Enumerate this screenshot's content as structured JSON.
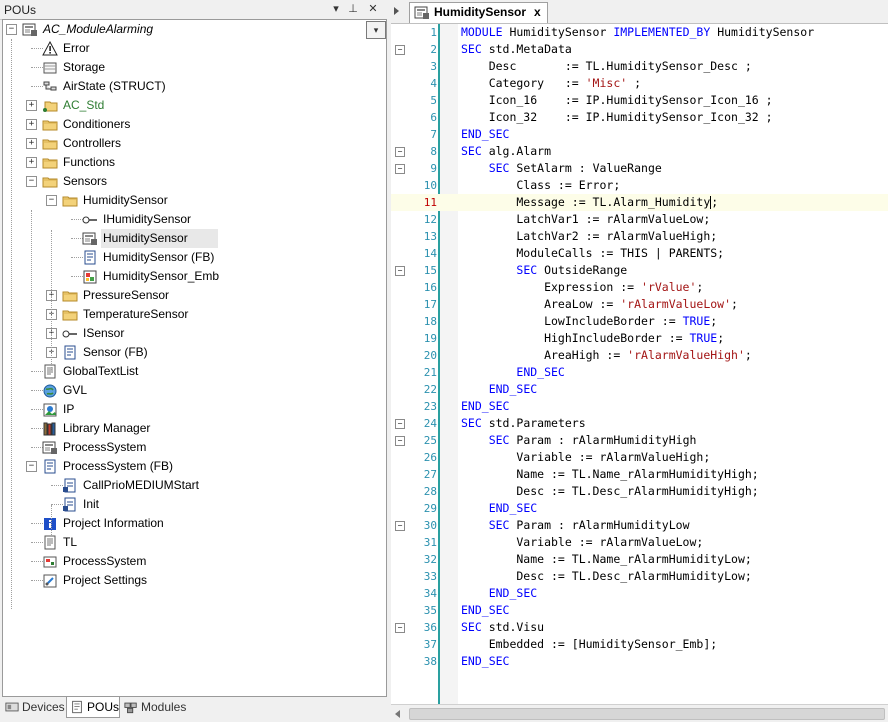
{
  "left_panel": {
    "title": "POUs",
    "buttons": {
      "dropdown": "▾",
      "pin": "⊥",
      "close": "✕"
    },
    "root_dropdown": "▾",
    "tree": [
      {
        "label": "AC_ModuleAlarming",
        "icon": "module-icon",
        "italic": true
      },
      {
        "label": "Error",
        "icon": "warning-icon"
      },
      {
        "label": "Storage",
        "icon": "storage-icon"
      },
      {
        "label": "AirState (STRUCT)",
        "icon": "struct-icon"
      },
      {
        "label": "AC_Std",
        "icon": "folder-link-icon",
        "color": "#2e7d32"
      },
      {
        "label": "Conditioners",
        "icon": "folder-icon"
      },
      {
        "label": "Controllers",
        "icon": "folder-icon"
      },
      {
        "label": "Functions",
        "icon": "folder-icon"
      },
      {
        "label": "Sensors",
        "icon": "folder-icon"
      },
      {
        "label": "HumiditySensor",
        "icon": "folder-icon"
      },
      {
        "label": "IHumiditySensor",
        "icon": "interface-icon"
      },
      {
        "label": "HumiditySensor",
        "icon": "module-icon",
        "selected": true
      },
      {
        "label": "HumiditySensor (FB)",
        "icon": "function-block-icon"
      },
      {
        "label": "HumiditySensor_Emb",
        "icon": "visualization-icon"
      },
      {
        "label": "PressureSensor",
        "icon": "folder-icon"
      },
      {
        "label": "TemperatureSensor",
        "icon": "folder-icon"
      },
      {
        "label": "ISensor",
        "icon": "interface-icon"
      },
      {
        "label": "Sensor (FB)",
        "icon": "function-block-icon"
      },
      {
        "label": "GlobalTextList",
        "icon": "text-list-icon"
      },
      {
        "label": "GVL",
        "icon": "globe-icon"
      },
      {
        "label": "IP",
        "icon": "image-pool-icon"
      },
      {
        "label": "Library Manager",
        "icon": "library-icon"
      },
      {
        "label": "ProcessSystem",
        "icon": "module-icon"
      },
      {
        "label": "ProcessSystem (FB)",
        "icon": "function-block-icon"
      },
      {
        "label": "CallPrioMEDIUMStart",
        "icon": "method-icon"
      },
      {
        "label": "Init",
        "icon": "method-icon"
      },
      {
        "label": "Project Information",
        "icon": "info-icon"
      },
      {
        "label": "TL",
        "icon": "text-list-icon"
      },
      {
        "label": "ProcessSystem",
        "icon": "task-icon"
      },
      {
        "label": "Project Settings",
        "icon": "settings-icon"
      }
    ]
  },
  "bottom_tabs": [
    {
      "label": "Devices",
      "icon": "devices-icon"
    },
    {
      "label": "POUs",
      "icon": "pous-icon",
      "active": true
    },
    {
      "label": "Modules",
      "icon": "modules-icon"
    }
  ],
  "editor": {
    "tab_title": "HumiditySensor",
    "tab_close": "x",
    "current_line": 11,
    "lines": [
      "MODULE HumiditySensor IMPLEMENTED_BY HumiditySensor",
      "SEC std.MetaData",
      "    Desc       := TL.HumiditySensor_Desc ;",
      "    Category   := 'Misc' ;",
      "    Icon_16    := IP.HumiditySensor_Icon_16 ;",
      "    Icon_32    := IP.HumiditySensor_Icon_32 ;",
      "END_SEC",
      "SEC alg.Alarm",
      "    SEC SetAlarm : ValueRange",
      "        Class := Error;",
      "        Message := TL.Alarm_Humidity;",
      "        LatchVar1 := rAlarmValueLow;",
      "        LatchVar2 := rAlarmValueHigh;",
      "        ModuleCalls := THIS | PARENTS;",
      "        SEC OutsideRange",
      "            Expression := 'rValue';",
      "            AreaLow := 'rAlarmValueLow';",
      "            LowIncludeBorder := TRUE;",
      "            HighIncludeBorder := TRUE;",
      "            AreaHigh := 'rAlarmValueHigh';",
      "        END_SEC",
      "    END_SEC",
      "END_SEC",
      "SEC std.Parameters",
      "    SEC Param : rAlarmHumidityHigh",
      "        Variable := rAlarmValueHigh;",
      "        Name := TL.Name_rAlarmHumidityHigh;",
      "        Desc := TL.Desc_rAlarmHumidityHigh;",
      "    END_SEC",
      "    SEC Param : rAlarmHumidityLow",
      "        Variable := rAlarmValueLow;",
      "        Name := TL.Name_rAlarmHumidityLow;",
      "        Desc := TL.Desc_rAlarmHumidityLow;",
      "    END_SEC",
      "END_SEC",
      "SEC std.Visu",
      "    Embedded := [HumiditySensor_Emb];",
      "END_SEC"
    ],
    "fold_lines": [
      2,
      8,
      9,
      15,
      24,
      25,
      30,
      36
    ],
    "fold_glyph": "−"
  },
  "colors": {
    "keyword": "#0000ff",
    "string": "#a31515",
    "line_number": "#2b91af",
    "gutter_bar": "#2aa0a0"
  }
}
